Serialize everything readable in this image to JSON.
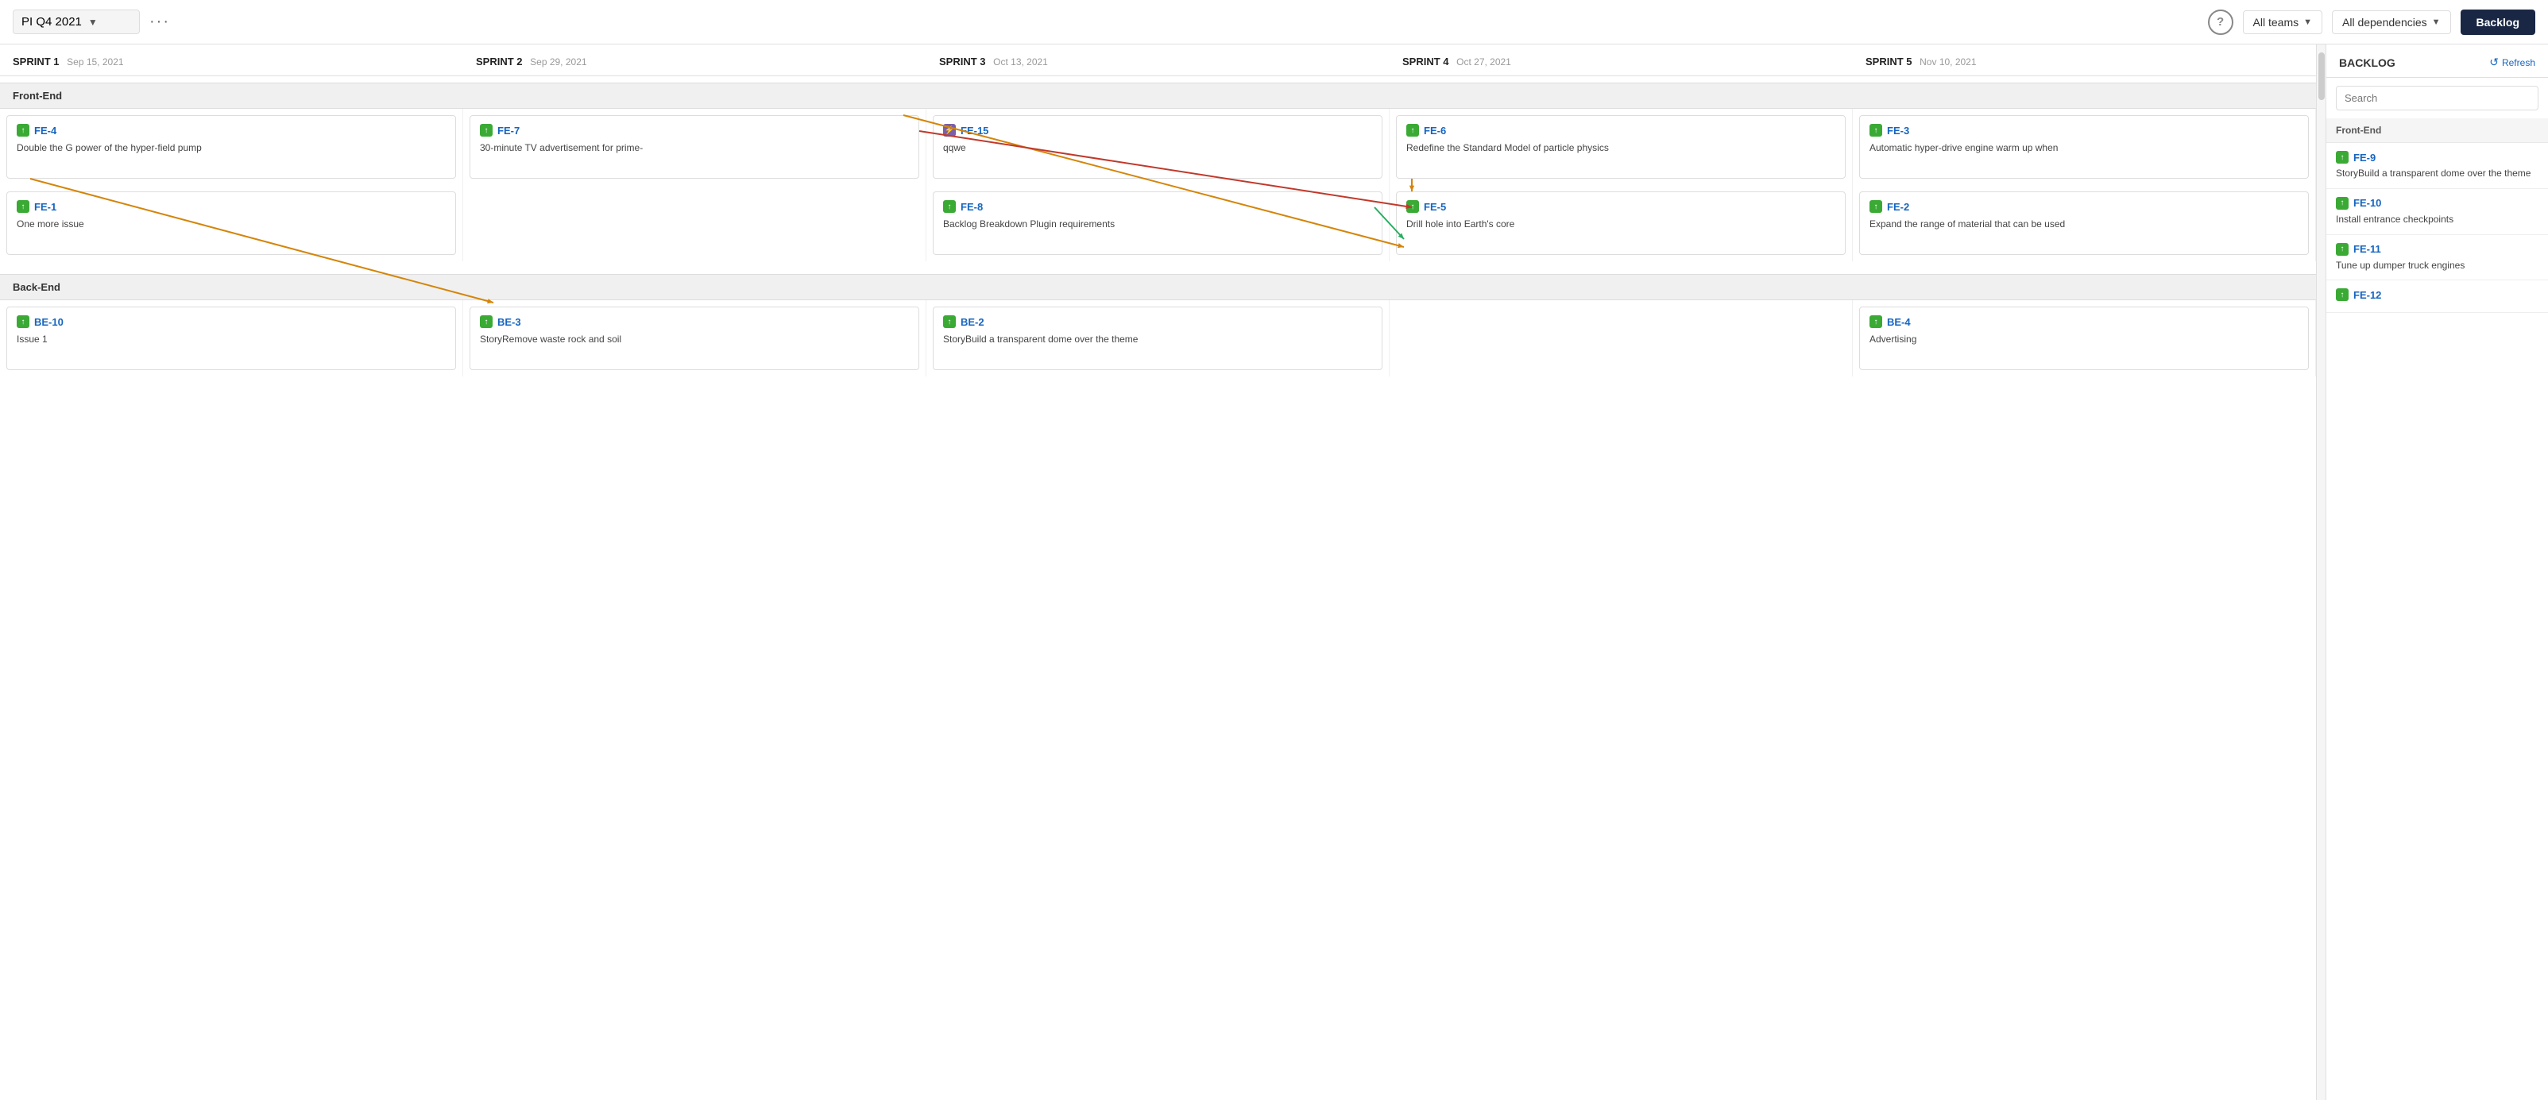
{
  "header": {
    "title": "PI Q4 2021",
    "dots": "···",
    "help": "?",
    "all_teams": "All teams",
    "all_dependencies": "All dependencies",
    "backlog_btn": "Backlog"
  },
  "sprints": [
    {
      "label": "SPRINT 1",
      "date": "Sep 15, 2021"
    },
    {
      "label": "SPRINT 2",
      "date": "Sep 29, 2021"
    },
    {
      "label": "SPRINT 3",
      "date": "Oct 13, 2021"
    },
    {
      "label": "SPRINT 4",
      "date": "Oct 27, 2021"
    },
    {
      "label": "SPRINT 5",
      "date": "Nov 10, 2021"
    }
  ],
  "groups": [
    {
      "name": "Front-End",
      "rows": [
        [
          {
            "id": "FE-4",
            "title": "Double the G power of the hyper-field pump",
            "icon": "green",
            "sprint": 0
          },
          {
            "id": "FE-7",
            "title": "30-minute TV advertisement for prime-",
            "icon": "green",
            "sprint": 1
          },
          {
            "id": "FE-15",
            "title": "qqwe",
            "icon": "purple",
            "sprint": 2
          },
          {
            "id": "FE-6",
            "title": "Redefine the Standard Model of particle physics",
            "icon": "green",
            "sprint": 3
          },
          {
            "id": "FE-3",
            "title": "Automatic hyper-drive engine warm up when",
            "icon": "green",
            "sprint": 4
          }
        ],
        [
          {
            "id": "FE-1",
            "title": "One more issue",
            "icon": "green",
            "sprint": 0
          },
          {
            "id": "FE-8",
            "title": "Backlog Breakdown Plugin requirements",
            "icon": "green",
            "sprint": 2
          },
          {
            "id": "FE-5",
            "title": "Drill hole into Earth's core",
            "icon": "green",
            "sprint": 3
          },
          {
            "id": "FE-2",
            "title": "Expand the range of material that can be used",
            "icon": "green",
            "sprint": 4
          }
        ]
      ]
    },
    {
      "name": "Back-End",
      "rows": [
        [
          {
            "id": "BE-10",
            "title": "Issue 1",
            "icon": "green",
            "sprint": 0
          },
          {
            "id": "BE-3",
            "title": "StoryRemove waste rock and soil",
            "icon": "green",
            "sprint": 1
          },
          {
            "id": "BE-2",
            "title": "StoryBuild a transparent dome over the theme",
            "icon": "green",
            "sprint": 2
          },
          {
            "id": "BE-4",
            "title": "Advertising",
            "icon": "green",
            "sprint": 4
          }
        ]
      ]
    }
  ],
  "backlog": {
    "title": "BACKLOG",
    "refresh": "Refresh",
    "search_placeholder": "Search",
    "groups": [
      {
        "name": "Front-End",
        "items": [
          {
            "id": "FE-9",
            "title": "StoryBuild a transparent dome over the theme"
          },
          {
            "id": "FE-10",
            "title": "Install entrance checkpoints"
          },
          {
            "id": "FE-11",
            "title": "Tune up dumper truck engines"
          },
          {
            "id": "FE-12",
            "title": ""
          }
        ]
      }
    ]
  },
  "icons": {
    "story_up_arrow": "↑",
    "lightning": "⚡",
    "refresh_symbol": "↺"
  }
}
